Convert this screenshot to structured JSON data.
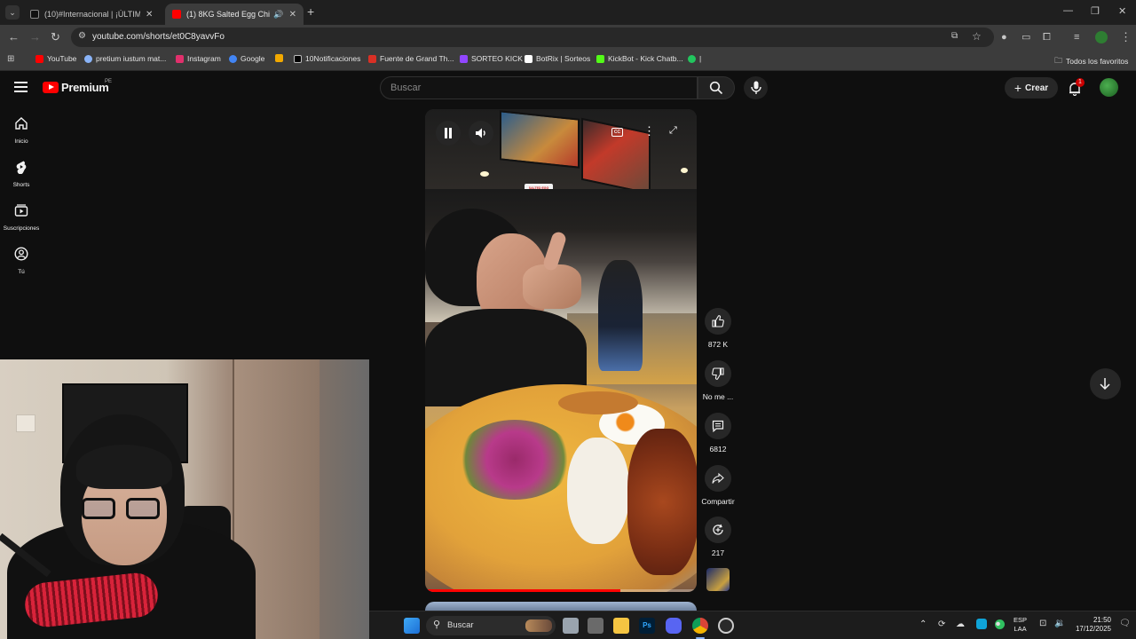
{
  "browser": {
    "tabs": [
      {
        "title": "(10)#Internacional | ¡ÚLTIMO M",
        "color": "#1a1a1a",
        "active": false
      },
      {
        "title": "(1) 8KG Salted Egg Chicken",
        "color": "#ff0000",
        "active": true
      }
    ],
    "url": "youtube.com/shorts/et0C8yavvFo",
    "bookmarks": [
      {
        "label": "YouTube",
        "color": "#ff0000"
      },
      {
        "label": "pretium iustum mat...",
        "color": "#8ab4f8"
      },
      {
        "label": "Instagram",
        "color": "#e1306c"
      },
      {
        "label": "Google",
        "color": "#4285f4"
      },
      {
        "label": "",
        "color": "#f2a900"
      },
      {
        "label": "10Notificaciones",
        "color": "#000000"
      },
      {
        "label": "Fuente de Grand Th...",
        "color": "#d93025"
      },
      {
        "label": "SORTEO KICK",
        "color": "#9146ff"
      },
      {
        "label": "BotRix | Sorteos",
        "color": "#ffffff"
      },
      {
        "label": "KickBot - Kick Chatb...",
        "color": "#53fc18"
      },
      {
        "label": "|",
        "color": "#22c55e"
      }
    ],
    "all_bookmarks": "Todos los favoritos"
  },
  "youtube": {
    "brand": "Premium",
    "region": "PE",
    "search_placeholder": "Buscar",
    "create_label": "Crear",
    "notification_count": "1",
    "nav": [
      {
        "label": "Inicio",
        "icon": "home-icon"
      },
      {
        "label": "Shorts",
        "icon": "shorts-icon"
      },
      {
        "label": "Suscripciones",
        "icon": "subscriptions-icon"
      },
      {
        "label": "Tú",
        "icon": "you-icon"
      }
    ],
    "short": {
      "sign_text": "SALTED EGG CHICKEN ORDER HERE",
      "progress": 0.72
    },
    "actions": {
      "likes": "872 K",
      "dislike": "No me ...",
      "comments": "6812",
      "share": "Compartir",
      "remix": "217"
    }
  },
  "taskbar": {
    "search_label": "Buscar",
    "lang_top": "ESP",
    "lang_bottom": "LAA",
    "time": "21:50",
    "date": "17/12/2025"
  }
}
